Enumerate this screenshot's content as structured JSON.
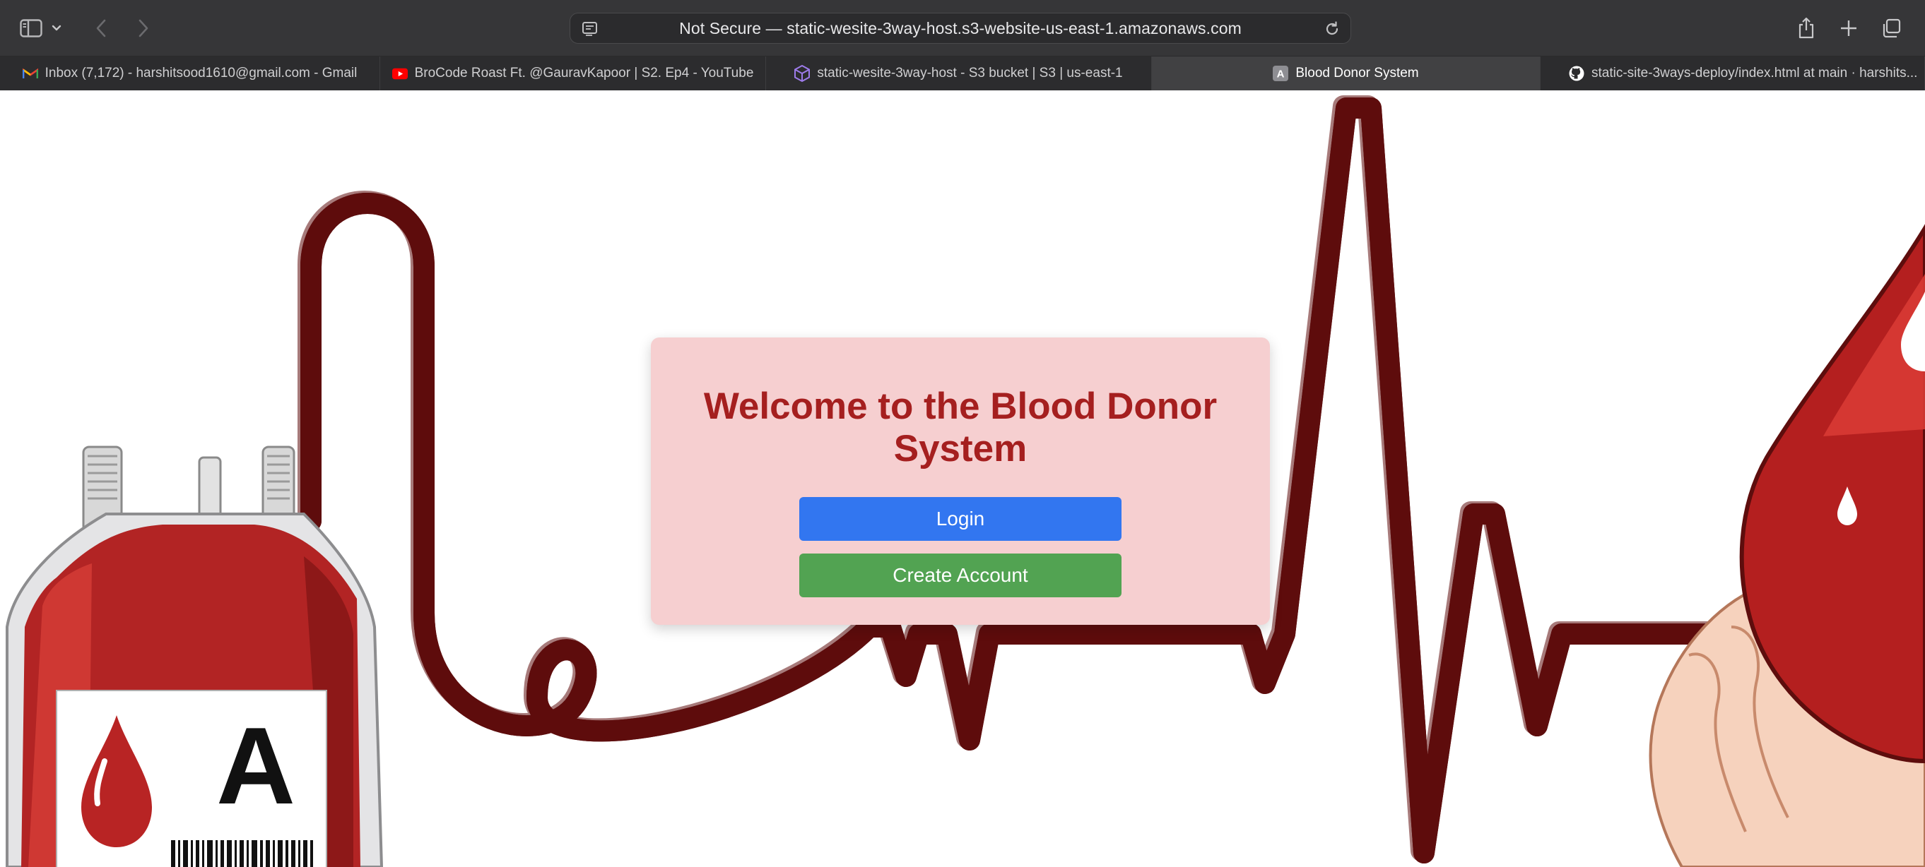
{
  "browser": {
    "url": "Not Secure — static-wesite-3way-host.s3-website-us-east-1.amazonaws.com",
    "tabs": [
      {
        "label": "Inbox (7,172) - harshitsood1610@gmail.com - Gmail",
        "icon": "gmail-icon"
      },
      {
        "label": "BroCode Roast Ft. @GauravKapoor | S2. Ep4 - YouTube",
        "icon": "youtube-icon"
      },
      {
        "label": "static-wesite-3way-host - S3 bucket | S3 | us-east-1",
        "icon": "aws-s3-icon"
      },
      {
        "label": "Blood Donor System",
        "icon": "letter-a-icon",
        "favicon_letter": "A",
        "active": true
      },
      {
        "label": "static-site-3ways-deploy/index.html at main · harshits...",
        "icon": "github-icon"
      }
    ]
  },
  "page": {
    "heading": "Welcome to the Blood Donor System",
    "login_label": "Login",
    "create_account_label": "Create Account",
    "bag_label": "A"
  },
  "colors": {
    "heading": "#a51f1f",
    "card_bg": "#f6cfd0",
    "login_button": "#3276f0",
    "create_button": "#52a352",
    "blood": "#c5292a"
  }
}
